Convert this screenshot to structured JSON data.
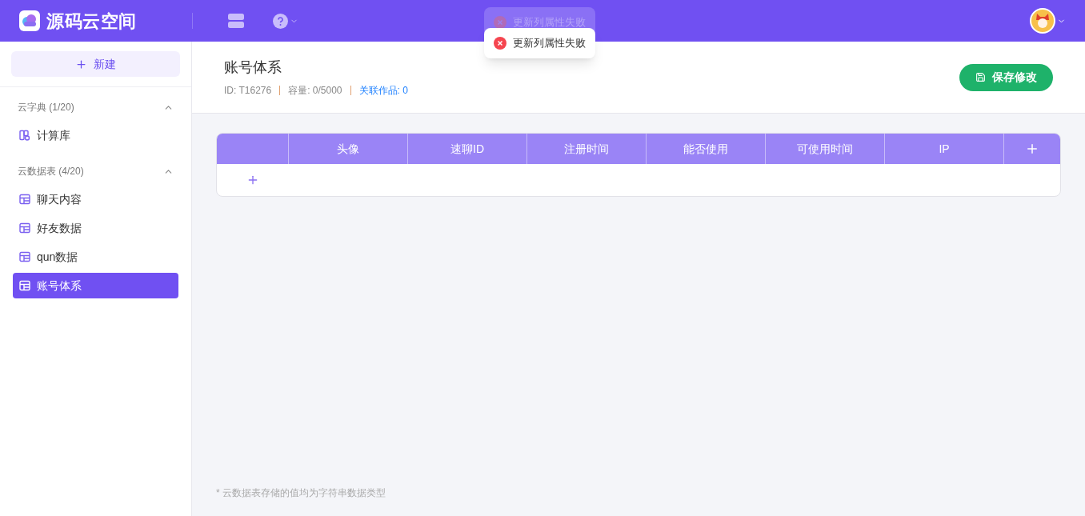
{
  "header": {
    "brand": "源码云空间"
  },
  "toasts": [
    {
      "faded": true,
      "text": "更新列属性失败"
    },
    {
      "faded": false,
      "text": "更新列属性失败"
    }
  ],
  "sidebar": {
    "new_button": "新建",
    "groups": [
      {
        "title": "云字典 (1/20)",
        "expanded": true,
        "items": [
          {
            "kind": "dictionary",
            "label": "计算库",
            "selected": false
          }
        ]
      },
      {
        "title": "云数据表 (4/20)",
        "expanded": true,
        "items": [
          {
            "kind": "table",
            "label": "聊天内容",
            "selected": false
          },
          {
            "kind": "table",
            "label": "好友数据",
            "selected": false
          },
          {
            "kind": "table",
            "label": "qun数据",
            "selected": false
          },
          {
            "kind": "table",
            "label": "账号体系",
            "selected": true
          }
        ]
      }
    ]
  },
  "page": {
    "title": "账号体系",
    "id": "ID: T16276",
    "capacity": "容量: 0/5000",
    "linked": "关联作品: 0",
    "save_button": "保存修改"
  },
  "table": {
    "columns": [
      "头像",
      "速聊ID",
      "注册时间",
      "能否使用",
      "可使用时间",
      "IP"
    ]
  },
  "footnote": "* 云数据表存储的值均为字符串数据类型"
}
